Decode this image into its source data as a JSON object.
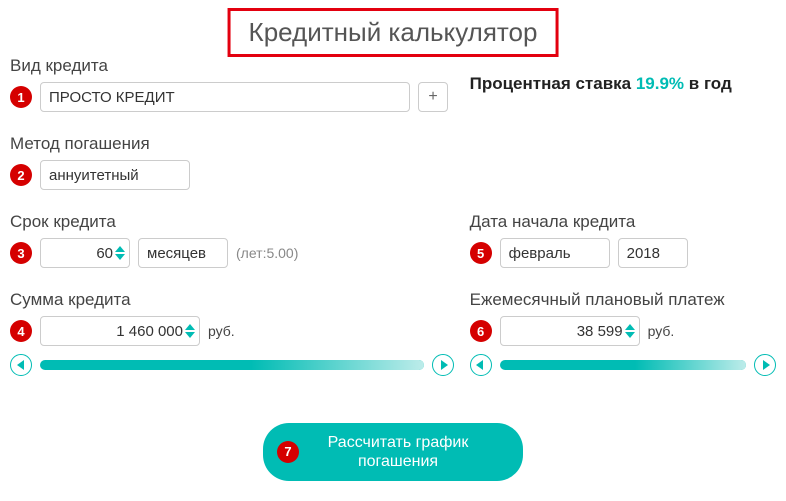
{
  "title": "Кредитный калькулятор",
  "markers": {
    "m1": "1",
    "m2": "2",
    "m3": "3",
    "m4": "4",
    "m5": "5",
    "m6": "6",
    "m7": "7"
  },
  "creditType": {
    "label": "Вид кредита",
    "value": "ПРОСТО КРЕДИТ",
    "plus": "+"
  },
  "rate": {
    "prefix": "Процентная ставка ",
    "value": "19.9%",
    "suffix": " в год"
  },
  "method": {
    "label": "Метод погашения",
    "value": "аннуитетный"
  },
  "term": {
    "label": "Срок кредита",
    "value": "60",
    "unit": "месяцев",
    "hint": "(лет:5.00)"
  },
  "startDate": {
    "label": "Дата начала кредита",
    "month": "февраль",
    "year": "2018"
  },
  "amount": {
    "label": "Сумма кредита",
    "value": "1 460 000",
    "unit": "руб."
  },
  "payment": {
    "label": "Ежемесячный плановый платеж",
    "value": "38 599",
    "unit": "руб."
  },
  "calcButton": "Рассчитать график погашения"
}
